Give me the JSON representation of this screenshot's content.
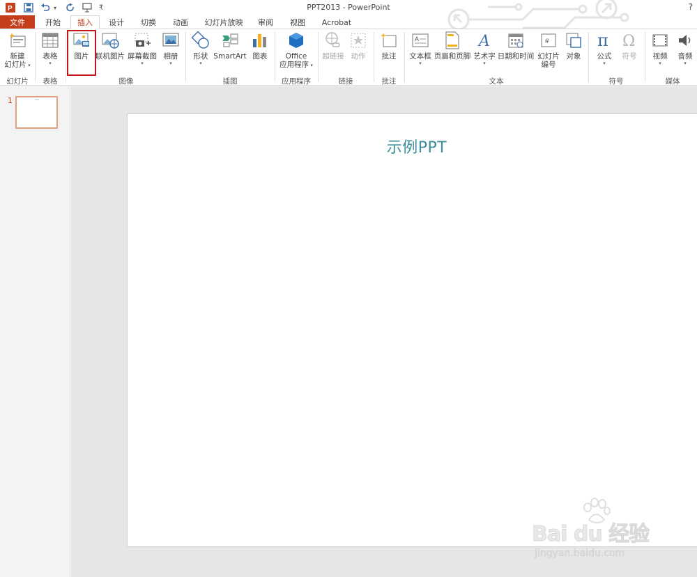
{
  "window": {
    "title": "PPT2013 - PowerPoint",
    "help": "?"
  },
  "qat": {
    "undo_caret": "▾",
    "customize": "₹"
  },
  "tabs": [
    {
      "label": "文件"
    },
    {
      "label": "开始"
    },
    {
      "label": "插入"
    },
    {
      "label": "设计"
    },
    {
      "label": "切换"
    },
    {
      "label": "动画"
    },
    {
      "label": "幻灯片放映"
    },
    {
      "label": "审阅"
    },
    {
      "label": "视图"
    },
    {
      "label": "Acrobat"
    }
  ],
  "ribbon": {
    "buttons": {
      "new_slide": {
        "line1": "新建",
        "line2": "幻灯片"
      },
      "table": {
        "label": "表格"
      },
      "picture": {
        "label": "图片"
      },
      "online_picture": {
        "label": "联机图片"
      },
      "screenshot": {
        "label": "屏幕截图"
      },
      "album": {
        "label": "相册"
      },
      "shapes": {
        "label": "形状"
      },
      "smartart": {
        "label": "SmartArt"
      },
      "chart": {
        "label": "图表"
      },
      "office_apps": {
        "line1": "Office",
        "line2": "应用程序"
      },
      "hyperlink": {
        "label": "超链接"
      },
      "action": {
        "label": "动作"
      },
      "comment": {
        "label": "批注"
      },
      "textbox": {
        "label": "文本框"
      },
      "header_footer": {
        "label": "页眉和页脚"
      },
      "wordart": {
        "label": "艺术字"
      },
      "datetime": {
        "label": "日期和时间"
      },
      "slide_number": {
        "line1": "幻灯片",
        "line2": "编号"
      },
      "object": {
        "label": "对象"
      },
      "equation": {
        "label": "公式"
      },
      "symbol": {
        "label": "符号"
      },
      "video": {
        "label": "视频"
      },
      "audio": {
        "label": "音频"
      }
    },
    "groups": {
      "slides": "幻灯片",
      "tables": "表格",
      "images": "图像",
      "illustrations": "插图",
      "apps": "应用程序",
      "links": "链接",
      "comments": "批注",
      "text": "文本",
      "symbols": "符号",
      "media": "媒体"
    }
  },
  "thumbnails": [
    {
      "number": "1"
    }
  ],
  "slide": {
    "title": "示例PPT"
  },
  "watermark": {
    "brand": "Bai du 经验",
    "url": "jingyan.baidu.com"
  },
  "colors": {
    "accent": "#c43e1c",
    "highlight": "#c0161b",
    "title": "#3c8e9c"
  }
}
